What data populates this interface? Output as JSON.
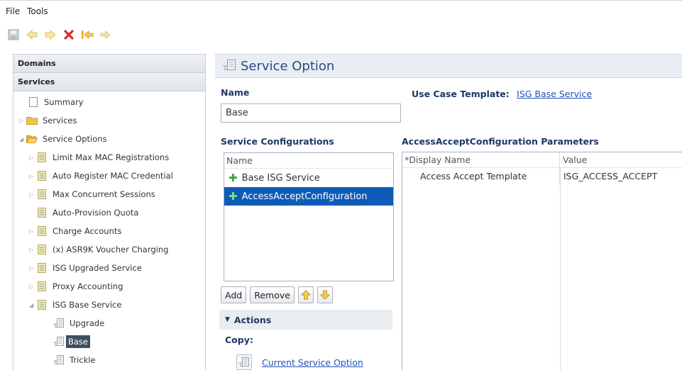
{
  "menu": {
    "file": "File",
    "tools": "Tools"
  },
  "toolbar": {
    "icons": [
      "save-icon",
      "undo-icon",
      "redo-icon",
      "delete-icon",
      "back-icon",
      "forward-icon"
    ]
  },
  "left_panel": {
    "domains_label": "Domains",
    "services_label": "Services",
    "tree": [
      {
        "label": "Summary"
      },
      {
        "label": "Services"
      },
      {
        "label": "Service Options"
      },
      {
        "label": "Limit Max MAC Registrations"
      },
      {
        "label": "Auto Register MAC Credential"
      },
      {
        "label": "Max Concurrent Sessions"
      },
      {
        "label": "Auto-Provision Quota"
      },
      {
        "label": "Charge Accounts"
      },
      {
        "label": "(x) ASR9K Voucher Charging"
      },
      {
        "label": "ISG Upgraded Service"
      },
      {
        "label": "Proxy Accounting"
      },
      {
        "label": "ISG Base Service"
      },
      {
        "label": "Upgrade"
      },
      {
        "label": "Base"
      },
      {
        "label": "Trickle"
      }
    ]
  },
  "main": {
    "title": "Service Option",
    "name_label": "Name",
    "name_value": "Base",
    "use_case_label": "Use Case Template:",
    "use_case_link": "ISG Base Service",
    "service_configs_label": "Service Configurations",
    "service_configs_col": "Name",
    "service_configs": [
      {
        "label": "Base ISG Service",
        "selected": false
      },
      {
        "label": "AccessAcceptConfiguration",
        "selected": true
      }
    ],
    "buttons": {
      "add": "Add",
      "remove": "Remove"
    },
    "params_label": "AccessAcceptConfiguration Parameters",
    "params_cols": {
      "display_name": "*Display Name",
      "value": "Value"
    },
    "params_rows": [
      {
        "display_name": "Access Accept Template",
        "value": "ISG_ACCESS_ACCEPT"
      }
    ],
    "actions_label": "Actions",
    "copy_label": "Copy:",
    "current_service_option": "Current Service Option"
  },
  "colors": {
    "selection_blue": "#0f5bb8",
    "heading_navy": "#1c3866",
    "link_blue": "#2250b8",
    "tree_selection": "#3f4f5f"
  }
}
